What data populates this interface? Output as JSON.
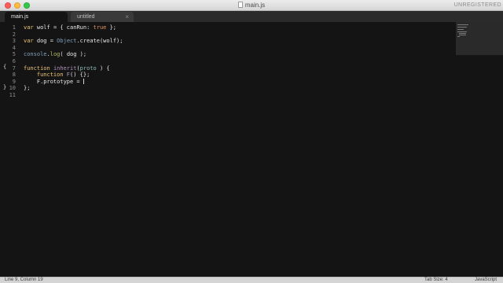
{
  "window": {
    "title": "main.js",
    "license_notice": "UNREGISTERED"
  },
  "tabs": [
    {
      "label": "main.js",
      "active": true
    },
    {
      "label": "untitled",
      "active": false
    }
  ],
  "editor": {
    "lines": [
      {
        "number": "1",
        "tokens": [
          [
            "kw",
            "var"
          ],
          [
            "",
            " wolf = { canRun: "
          ],
          [
            "bool",
            "true"
          ],
          [
            "",
            " };"
          ]
        ]
      },
      {
        "number": "2",
        "tokens": []
      },
      {
        "number": "3",
        "tokens": [
          [
            "kw",
            "var"
          ],
          [
            "",
            " dog = "
          ],
          [
            "obj",
            "Object"
          ],
          [
            "",
            ".create(wolf);"
          ]
        ]
      },
      {
        "number": "4",
        "tokens": []
      },
      {
        "number": "5",
        "tokens": [
          [
            "obj",
            "console"
          ],
          [
            "",
            "."
          ],
          [
            "mth",
            "log"
          ],
          [
            "",
            "( dog );"
          ]
        ]
      },
      {
        "number": "6",
        "tokens": []
      },
      {
        "number": "7",
        "tokens": [
          [
            "kw",
            "function"
          ],
          [
            "",
            " "
          ],
          [
            "fn",
            "inherit"
          ],
          [
            "",
            "("
          ],
          [
            "param",
            "proto"
          ],
          [
            "",
            " ) {"
          ]
        ]
      },
      {
        "number": "8",
        "tokens": [
          [
            "",
            "    "
          ],
          [
            "kw",
            "function"
          ],
          [
            "",
            " "
          ],
          [
            "fn",
            "F"
          ],
          [
            "",
            "() {};"
          ]
        ]
      },
      {
        "number": "9",
        "tokens": [
          [
            "",
            "    F.prototype = "
          ]
        ],
        "caret": true
      },
      {
        "number": "10",
        "tokens": [
          [
            "",
            "};"
          ]
        ]
      },
      {
        "number": "11",
        "tokens": []
      }
    ],
    "fold_marks": {
      "open": "{",
      "close": "}"
    }
  },
  "status": {
    "position": "Line 9, Column 19",
    "tab_size": "Tab Size: 4",
    "syntax": "JavaScript"
  }
}
